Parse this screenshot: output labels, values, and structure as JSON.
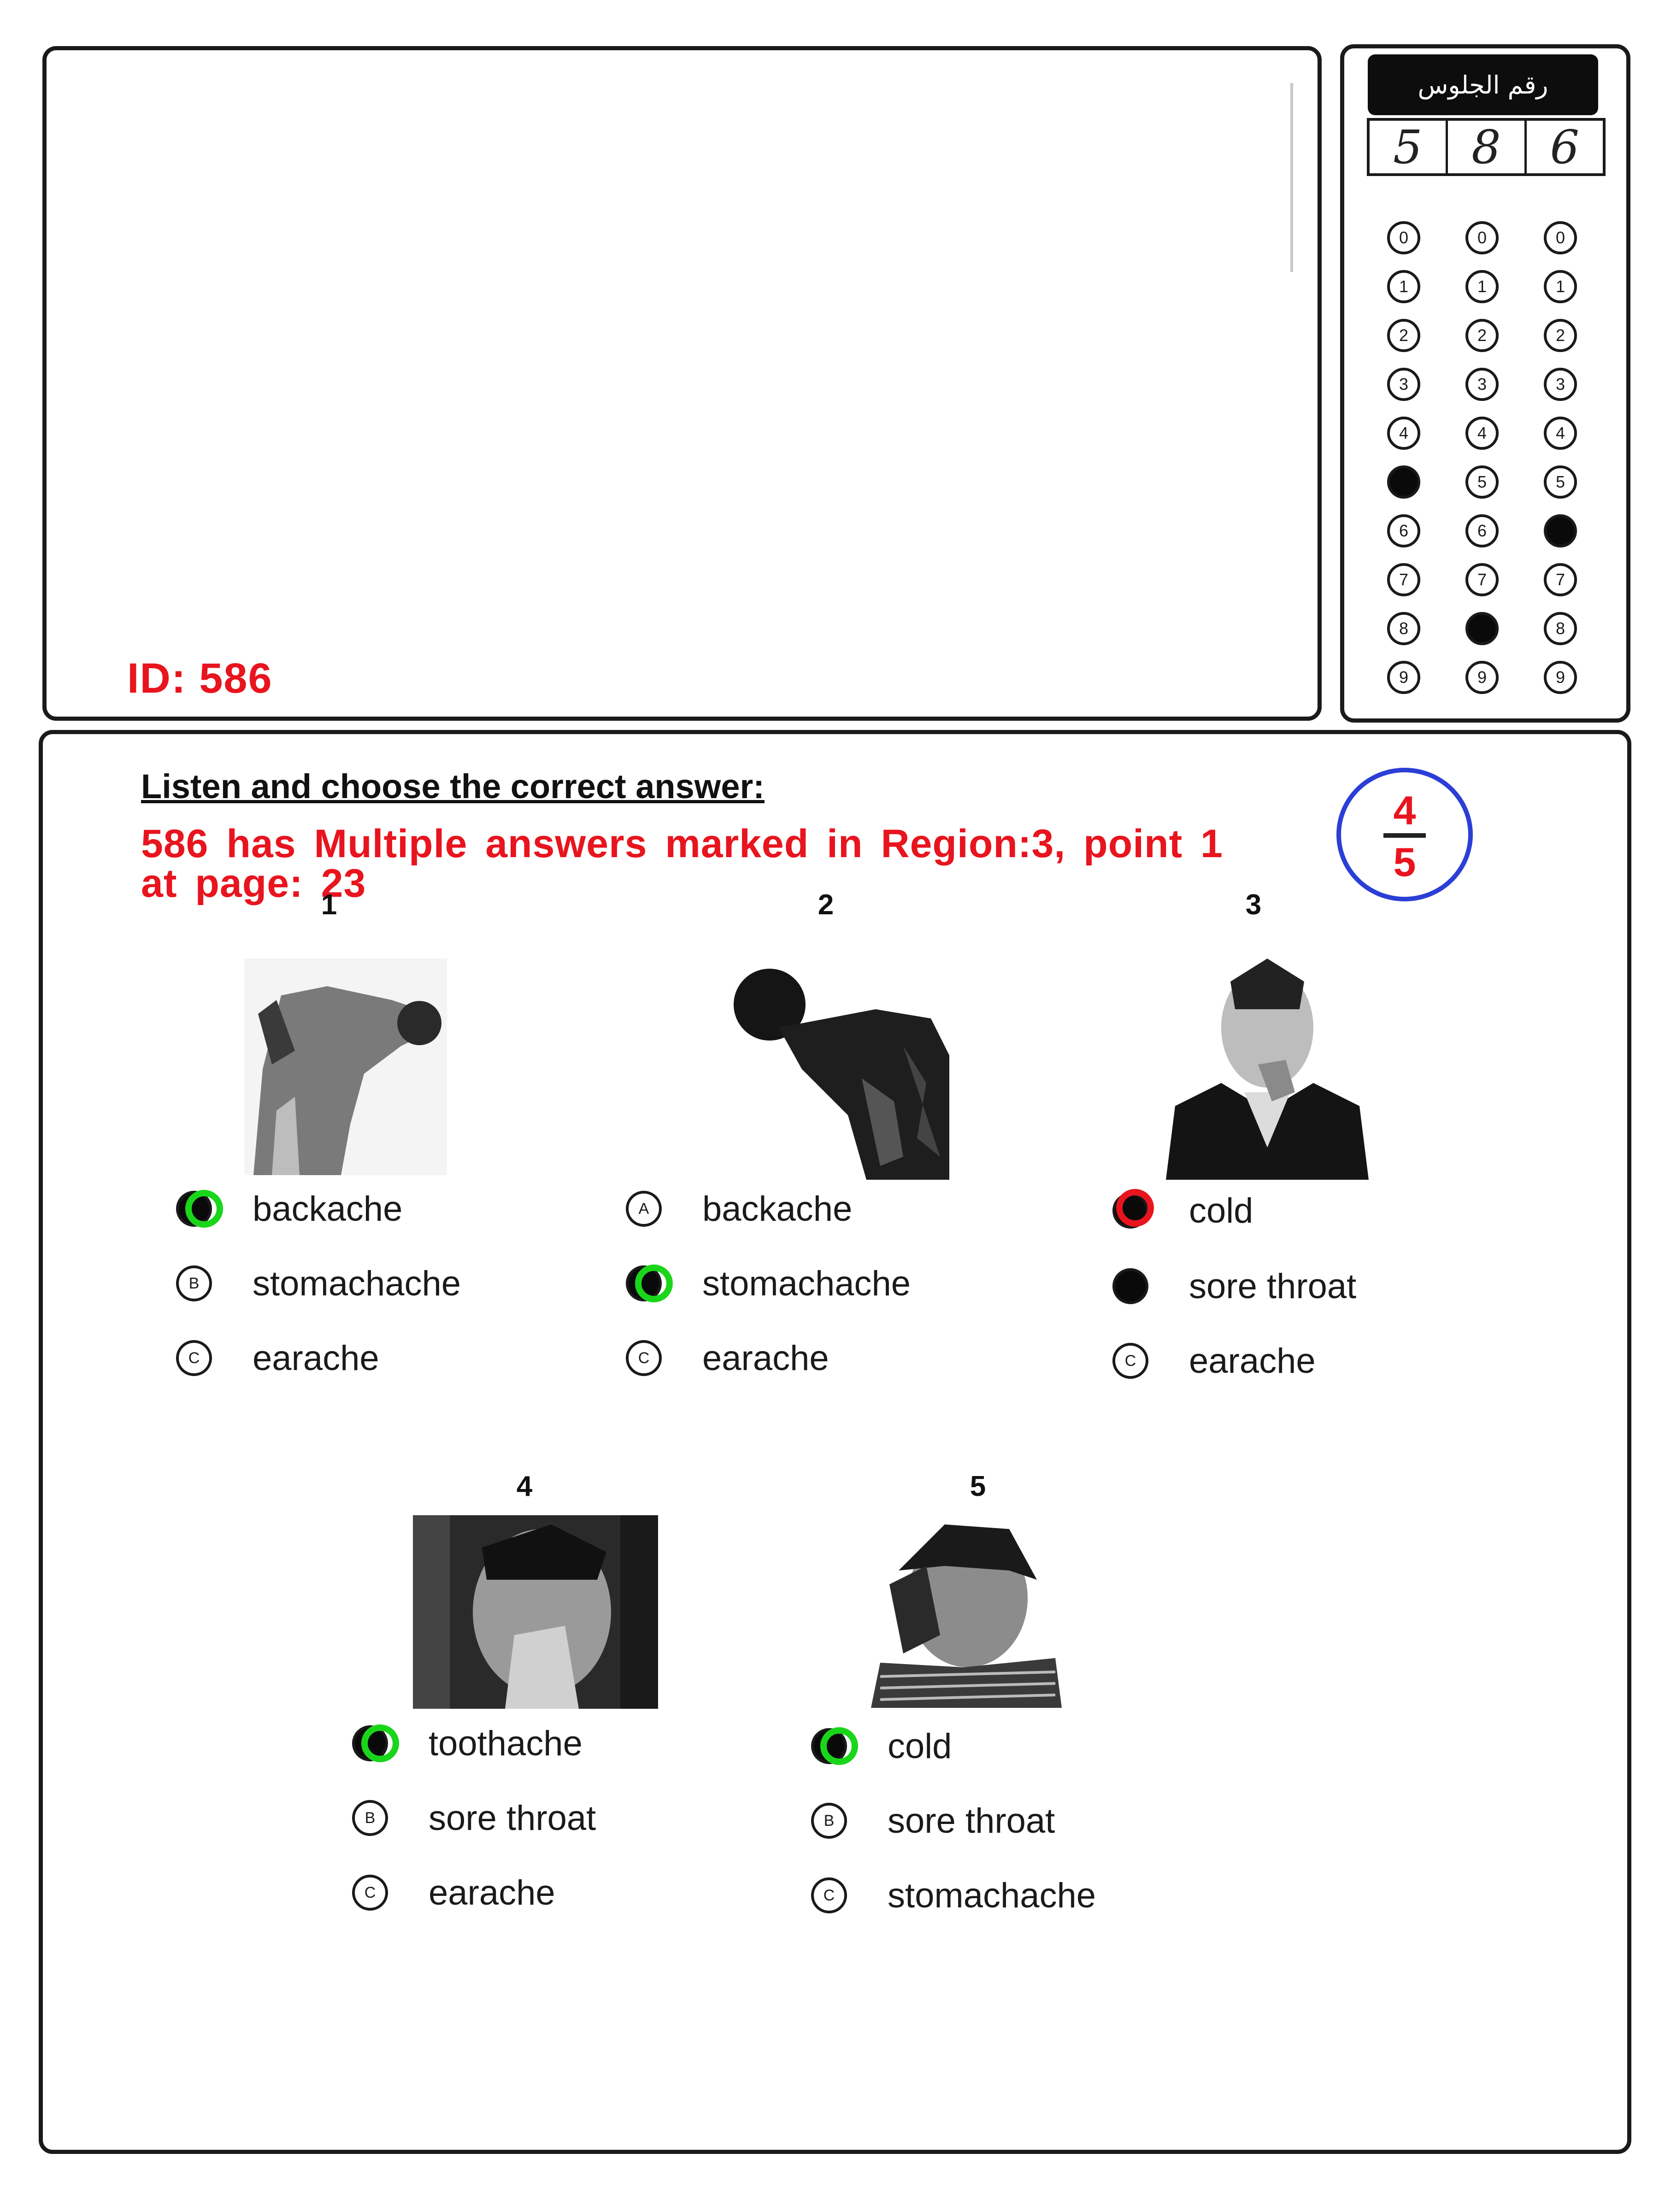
{
  "page": {
    "id_label": "ID: 586",
    "seat_header": "رقم الجلوس",
    "seat_digits": [
      "5",
      "8",
      "6"
    ],
    "seat_columns": [
      {
        "filled": 5
      },
      {
        "filled": 8
      },
      {
        "filled": 6
      }
    ],
    "bubble_labels": [
      "0",
      "1",
      "2",
      "3",
      "4",
      "5",
      "6",
      "7",
      "8",
      "9"
    ]
  },
  "section": {
    "instructions": "Listen and choose the correct answer:",
    "error_line1": "586 has Multiple answers marked in Region:3, point 1",
    "error_line2": "at page: 23",
    "score_obtained": "4",
    "score_total": "5"
  },
  "questions": [
    {
      "number": "1",
      "options": [
        {
          "letter": "A",
          "text": "backache",
          "marked": true,
          "result": "correct"
        },
        {
          "letter": "B",
          "text": "stomachache",
          "marked": false
        },
        {
          "letter": "C",
          "text": "earache",
          "marked": false
        }
      ]
    },
    {
      "number": "2",
      "options": [
        {
          "letter": "A",
          "text": "backache",
          "marked": false
        },
        {
          "letter": "B",
          "text": "stomachache",
          "marked": true,
          "result": "correct"
        },
        {
          "letter": "C",
          "text": "earache",
          "marked": false
        }
      ]
    },
    {
      "number": "3",
      "options": [
        {
          "letter": "A",
          "text": "cold",
          "marked": true,
          "result": "wrong"
        },
        {
          "letter": "B",
          "text": "sore throat",
          "marked": true
        },
        {
          "letter": "C",
          "text": "earache",
          "marked": false
        }
      ]
    },
    {
      "number": "4",
      "options": [
        {
          "letter": "A",
          "text": "toothache",
          "marked": true,
          "result": "correct"
        },
        {
          "letter": "B",
          "text": "sore throat",
          "marked": false
        },
        {
          "letter": "C",
          "text": "earache",
          "marked": false
        }
      ]
    },
    {
      "number": "5",
      "options": [
        {
          "letter": "A",
          "text": "cold",
          "marked": true,
          "result": "correct"
        },
        {
          "letter": "B",
          "text": "sore throat",
          "marked": false
        },
        {
          "letter": "C",
          "text": "stomachache",
          "marked": false
        }
      ]
    }
  ],
  "colors": {
    "correct_ring": "#1ad61a",
    "wrong_ring": "#e8141e",
    "annotation_text": "#e8141e",
    "score_circle": "#2b3fd6"
  }
}
